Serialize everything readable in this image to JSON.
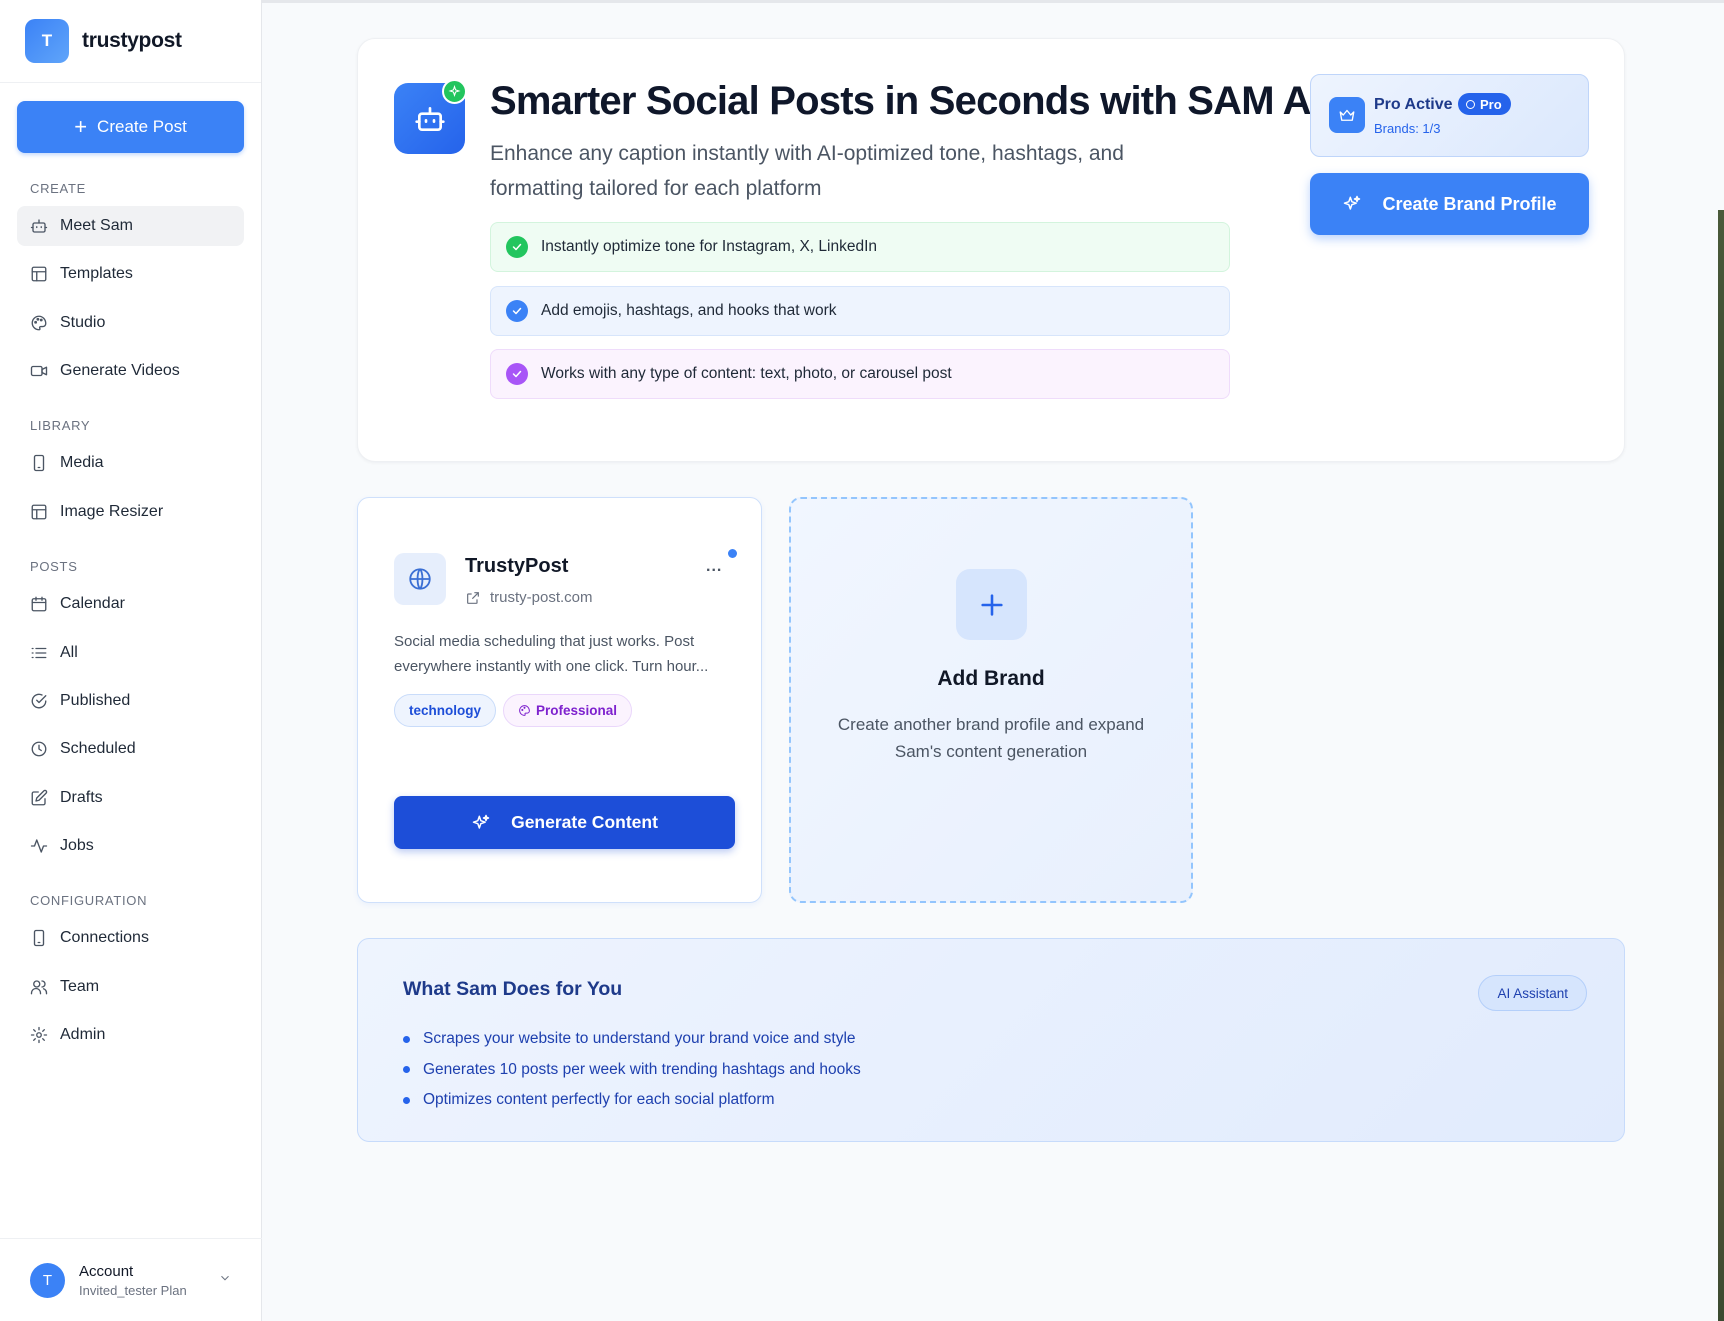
{
  "app": {
    "name": "trustypost",
    "logo_letter": "T"
  },
  "sidebar": {
    "create_post_label": "Create Post",
    "sections": {
      "create": "CREATE",
      "library": "LIBRARY",
      "posts": "POSTS",
      "configuration": "CONFIGURATION"
    },
    "items": {
      "meet_sam": "Meet Sam",
      "templates": "Templates",
      "studio": "Studio",
      "generate_videos": "Generate Videos",
      "media": "Media",
      "image_resizer": "Image Resizer",
      "calendar": "Calendar",
      "all": "All",
      "published": "Published",
      "scheduled": "Scheduled",
      "drafts": "Drafts",
      "jobs": "Jobs",
      "connections": "Connections",
      "team": "Team",
      "admin": "Admin"
    },
    "active_item": "meet_sam",
    "account": {
      "avatar_letter": "T",
      "name": "Account",
      "plan": "Invited_tester Plan"
    }
  },
  "hero": {
    "title": "Smarter Social Posts in Seconds with SAM AI",
    "subtitle": "Enhance any caption instantly with AI-optimized tone, hashtags, and formatting tailored for each platform",
    "features": [
      "Instantly optimize tone for Instagram, X, LinkedIn",
      "Add emojis, hashtags, and hooks that work",
      "Works with any type of content: text, photo, or carousel post"
    ],
    "plan": {
      "title": "Pro Active",
      "badge": "Pro",
      "brands": "Brands: 1/3"
    },
    "create_brand_profile_label": "Create Brand Profile"
  },
  "brand_card": {
    "name": "TrustyPost",
    "url": "trusty-post.com",
    "more_label": "...",
    "description": "Social media scheduling that just works. Post everywhere instantly with one click. Turn hour...",
    "tags": {
      "industry": "technology",
      "tone": "Professional"
    },
    "generate_label": "Generate Content"
  },
  "add_brand": {
    "title": "Add Brand",
    "description": "Create another brand profile and expand Sam's content generation"
  },
  "sam_info": {
    "title": "What Sam Does for You",
    "badge": "AI Assistant",
    "points": [
      "Scrapes your website to understand your brand voice and style",
      "Generates 10 posts per week with trending hashtags and hooks",
      "Optimizes content perfectly for each social platform"
    ]
  },
  "colors": {
    "accent": "#3b82f6",
    "accent_dark": "#1d4ed8",
    "success": "#22c55e",
    "purple": "#a855f7"
  }
}
